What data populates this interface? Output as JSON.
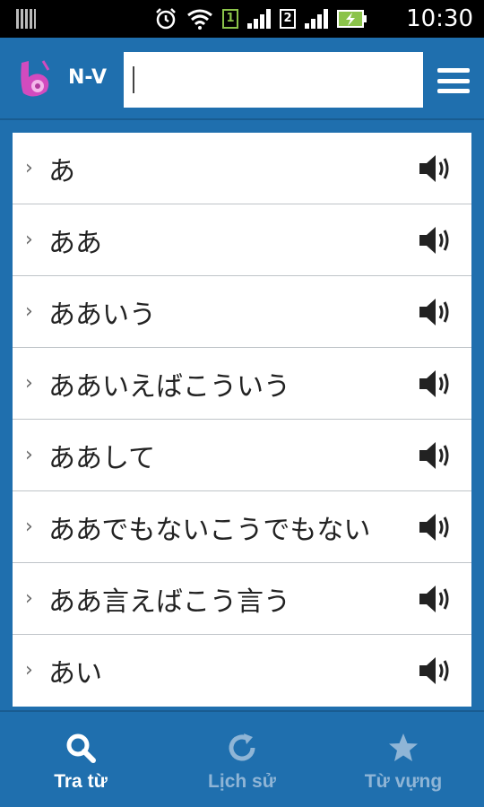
{
  "status_bar": {
    "time": "10:30",
    "sim1": "1",
    "sim2": "2",
    "icons": [
      "notification-icon",
      "alarm-icon",
      "wifi-icon",
      "signal-icon",
      "battery-charging-icon"
    ]
  },
  "header": {
    "logo_icon": "app-logo-icon",
    "language_label": "N-V",
    "search": {
      "value": "",
      "placeholder": ""
    },
    "menu_icon": "hamburger-menu-icon"
  },
  "word_list": [
    {
      "word": "あ"
    },
    {
      "word": "ああ"
    },
    {
      "word": "ああいう"
    },
    {
      "word": "ああいえばこういう"
    },
    {
      "word": "ああして"
    },
    {
      "word": "ああでもないこうでもない"
    },
    {
      "word": "ああ言えばこう言う"
    },
    {
      "word": "あい"
    }
  ],
  "bottom_nav": {
    "tabs": [
      {
        "label": "Tra từ",
        "icon": "search-icon",
        "active": true
      },
      {
        "label": "Lịch sử",
        "icon": "history-icon",
        "active": false
      },
      {
        "label": "Từ vựng",
        "icon": "star-icon",
        "active": false
      }
    ]
  },
  "colors": {
    "primary": "#1f6fae",
    "logo_accent": "#d24bbf",
    "inactive_tab_text": "#8fb5d6"
  }
}
